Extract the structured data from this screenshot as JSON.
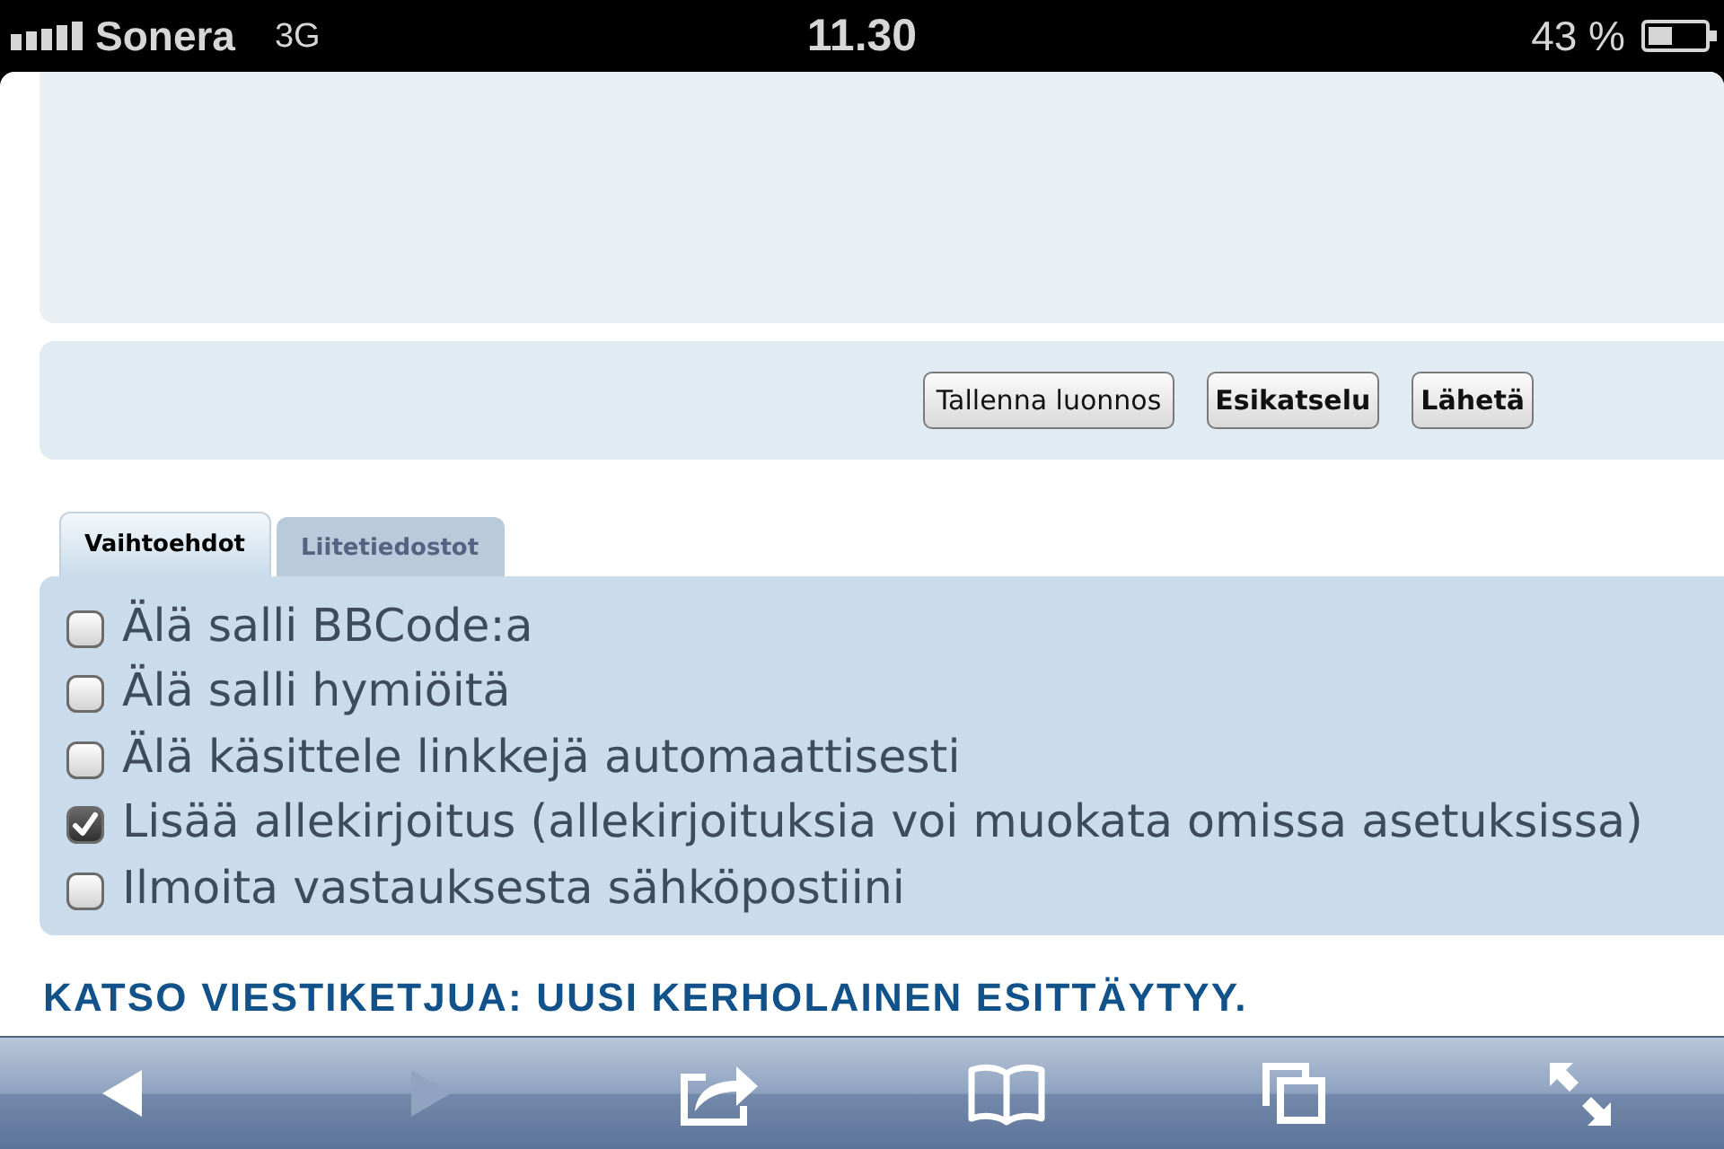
{
  "status_bar": {
    "carrier": "Sonera",
    "network": "3G",
    "time": "11.30",
    "battery": "43 %"
  },
  "buttons": [
    {
      "label": "Tallenna luonnos",
      "kind": "secondary"
    },
    {
      "label": "Esikatselu",
      "kind": "primary"
    },
    {
      "label": "Lähetä",
      "kind": "primary"
    }
  ],
  "tabs": [
    {
      "label": "Vaihtoehdot",
      "selected": true
    },
    {
      "label": "Liitetiedostot",
      "selected": false
    }
  ],
  "options": [
    {
      "label": "Älä salli BBCode:a",
      "checked": false
    },
    {
      "label": "Älä salli hymiöitä",
      "checked": false
    },
    {
      "label": "Älä käsittele linkkejä automaattisesti",
      "checked": false
    },
    {
      "label": "Lisää allekirjoitus (allekirjoituksia voi muokata omissa asetuksissa)",
      "checked": true
    },
    {
      "label": "Ilmoita vastauksesta sähköpostiini",
      "checked": false
    }
  ],
  "topic_link": "KATSO VIESTIKETJUA: UUSI KERHOLAINEN ESITTÄYTYY.",
  "toolbar": [
    {
      "kind": "back",
      "disabled": false
    },
    {
      "kind": "forward",
      "disabled": true
    },
    {
      "kind": "share",
      "disabled": false
    },
    {
      "kind": "bookmarks",
      "disabled": false
    },
    {
      "kind": "tabs",
      "disabled": false
    },
    {
      "kind": "fullscreen",
      "disabled": false
    }
  ]
}
